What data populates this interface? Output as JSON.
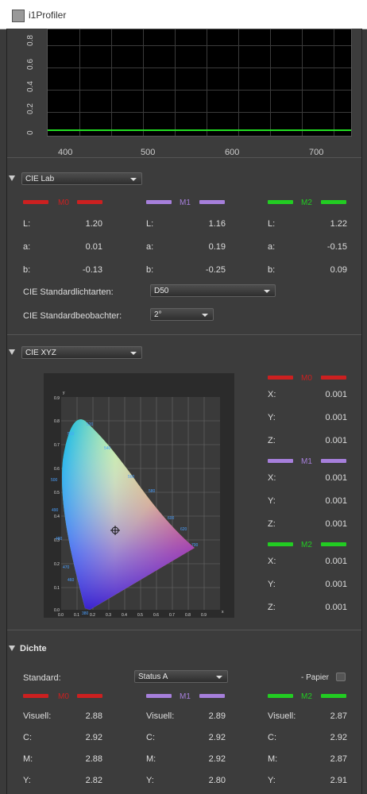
{
  "window": {
    "title": "i1Profiler"
  },
  "spectrum": {
    "y_ticks": [
      "0",
      "0.2",
      "0.4",
      "0.6",
      "0.8"
    ],
    "x_ticks": [
      "400",
      "500",
      "600",
      "700"
    ],
    "line_color": "#22dd22"
  },
  "cie_lab": {
    "dropdown": "CIE Lab",
    "m0": {
      "label": "M0",
      "color": "#cc2020",
      "L": "1.20",
      "a": "0.01",
      "b": "-0.13"
    },
    "m1": {
      "label": "M1",
      "color": "#a67fdb",
      "L": "1.16",
      "a": "0.19",
      "b": "-0.25"
    },
    "m2": {
      "label": "M2",
      "color": "#22cc22",
      "L": "1.22",
      "a": "-0.15",
      "b": "0.09"
    },
    "labels": {
      "L": "L:",
      "a": "a:",
      "b": "b:"
    },
    "illuminant_label": "CIE Standardlichtarten:",
    "illuminant_value": "D50",
    "observer_label": "CIE Standardbeobachter:",
    "observer_value": "2°"
  },
  "cie_xyz": {
    "dropdown": "CIE XYZ",
    "labels": {
      "X": "X:",
      "Y": "Y:",
      "Z": "Z:"
    },
    "m0": {
      "label": "M0",
      "X": "0.001",
      "Y": "0.001",
      "Z": "0.001"
    },
    "m1": {
      "label": "M1",
      "X": "0.001",
      "Y": "0.001",
      "Z": "0.001"
    },
    "m2": {
      "label": "M2",
      "X": "0.001",
      "Y": "0.001",
      "Z": "0.001"
    },
    "diagram": {
      "x_ticks": [
        "0.0",
        "0.1",
        "0.2",
        "0.3",
        "0.4",
        "0.5",
        "0.6",
        "0.7",
        "0.8",
        "0.9"
      ],
      "y_ticks": [
        "0.0",
        "0.1",
        "0.2",
        "0.3",
        "0.4",
        "0.5",
        "0.6",
        "0.7",
        "0.8",
        "0.9"
      ],
      "x_axis": "x",
      "y_axis": "y",
      "wavelengths": [
        "380",
        "460",
        "470",
        "480",
        "490",
        "500",
        "510",
        "520",
        "540",
        "560",
        "580",
        "600",
        "620",
        "700"
      ]
    }
  },
  "dichte": {
    "heading": "Dichte",
    "standard_label": "Standard:",
    "standard_value": "Status A",
    "paper_label": "- Papier",
    "labels": {
      "vis": "Visuell:",
      "c": "C:",
      "m": "M:",
      "y": "Y:"
    },
    "m0": {
      "label": "M0",
      "vis": "2.88",
      "c": "2.92",
      "m": "2.88",
      "y": "2.82"
    },
    "m1": {
      "label": "M1",
      "vis": "2.89",
      "c": "2.92",
      "m": "2.92",
      "y": "2.80"
    },
    "m2": {
      "label": "M2",
      "vis": "2.87",
      "c": "2.92",
      "m": "2.87",
      "y": "2.91"
    }
  }
}
